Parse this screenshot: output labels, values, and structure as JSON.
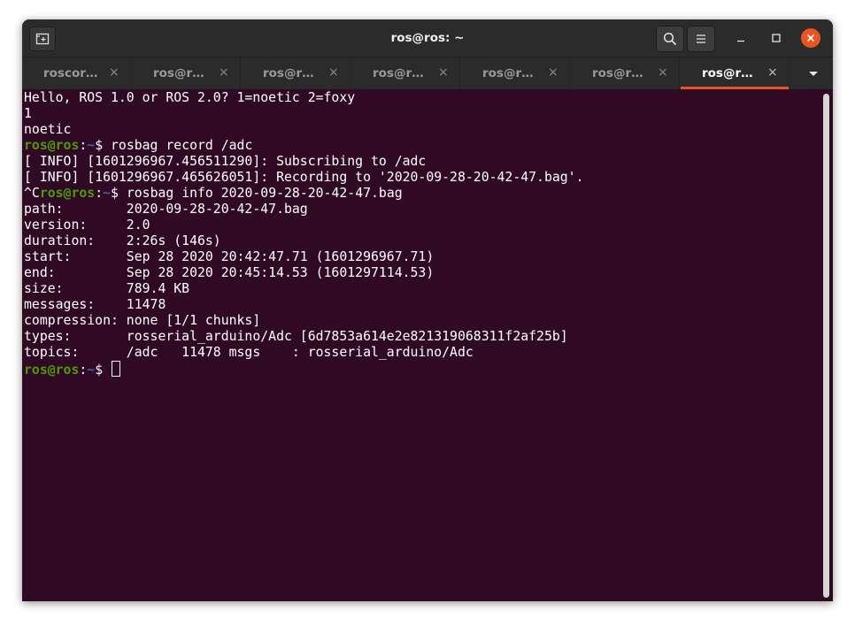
{
  "window": {
    "title": "ros@ros: ~"
  },
  "tabs": [
    {
      "label": "roscor…",
      "active": false
    },
    {
      "label": "ros@r…",
      "active": false
    },
    {
      "label": "ros@r…",
      "active": false
    },
    {
      "label": "ros@r…",
      "active": false
    },
    {
      "label": "ros@r…",
      "active": false
    },
    {
      "label": "ros@r…",
      "active": false
    },
    {
      "label": "ros@r…",
      "active": true
    }
  ],
  "tab_close_glyph": "×",
  "icons": {
    "new_tab": "new-tab-icon",
    "search": "search-icon",
    "menu": "hamburger-menu-icon",
    "minimize": "minimize-icon",
    "maximize": "maximize-icon",
    "close": "close-icon",
    "tab_dropdown": "chevron-down-icon"
  },
  "colors": {
    "terminal_bg": "#300a24",
    "prompt_user": "#4e9a06",
    "prompt_path": "#3465a4",
    "accent": "#e95420"
  },
  "terminal": {
    "lines": [
      {
        "text": "Hello, ROS 1.0 or ROS 2.0? 1=noetic 2=foxy"
      },
      {
        "text": "1"
      },
      {
        "text": "noetic"
      },
      {
        "prefix": "",
        "user": "ros@ros",
        "sep": ":",
        "path": "~",
        "suffix": "$ rosbag record /adc"
      },
      {
        "text": "[ INFO] [1601296967.456511290]: Subscribing to /adc"
      },
      {
        "text": "[ INFO] [1601296967.465626051]: Recording to '2020-09-28-20-42-47.bag'."
      },
      {
        "prefix": "^C",
        "user": "ros@ros",
        "sep": ":",
        "path": "~",
        "suffix": "$ rosbag info 2020-09-28-20-42-47.bag"
      },
      {
        "text": "path:        2020-09-28-20-42-47.bag"
      },
      {
        "text": "version:     2.0"
      },
      {
        "text": "duration:    2:26s (146s)"
      },
      {
        "text": "start:       Sep 28 2020 20:42:47.71 (1601296967.71)"
      },
      {
        "text": "end:         Sep 28 2020 20:45:14.53 (1601297114.53)"
      },
      {
        "text": "size:        789.4 KB"
      },
      {
        "text": "messages:    11478"
      },
      {
        "text": "compression: none [1/1 chunks]"
      },
      {
        "text": "types:       rosserial_arduino/Adc [6d7853a614e2e821319068311f2af25b]"
      },
      {
        "text": "topics:      /adc   11478 msgs    : rosserial_arduino/Adc"
      },
      {
        "prefix": "",
        "user": "ros@ros",
        "sep": ":",
        "path": "~",
        "suffix": "$ ",
        "cursor": true
      }
    ]
  }
}
